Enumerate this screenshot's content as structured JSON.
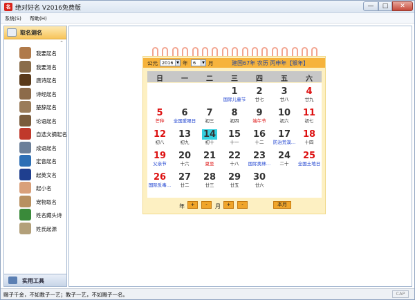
{
  "window": {
    "title": "绝对好名 V2016免费版",
    "icon": "app-icon"
  },
  "menu": [
    {
      "label": "系统(S)"
    },
    {
      "label": "帮助(H)"
    }
  ],
  "sidebar": {
    "header": "取名测名",
    "scroll_up": "⌃",
    "items": [
      {
        "label": "我要起名",
        "icon": "person-icon",
        "color": "#b07a4a"
      },
      {
        "label": "我要测名",
        "icon": "magnifier-person-icon",
        "color": "#8a6d4a"
      },
      {
        "label": "唐诗起名",
        "icon": "tang-seal-icon",
        "color": "#5a3a1a"
      },
      {
        "label": "诗经起名",
        "icon": "scroll-painting-icon",
        "color": "#8c6b4a"
      },
      {
        "label": "楚辞起名",
        "icon": "ancient-figure-icon",
        "color": "#9a7c5a"
      },
      {
        "label": "论语起名",
        "icon": "confucius-icon",
        "color": "#7a5c3c"
      },
      {
        "label": "自选文摘起名",
        "icon": "books-icon",
        "color": "#c0392b"
      },
      {
        "label": "成语起名",
        "icon": "book-icon",
        "color": "#6b7f99"
      },
      {
        "label": "定音起名",
        "icon": "globe-icon",
        "color": "#2d6fb5"
      },
      {
        "label": "起英文名",
        "icon": "uk-flag-icon",
        "color": "#1f3f8f"
      },
      {
        "label": "起小名",
        "icon": "baby-icon",
        "color": "#d9a07a"
      },
      {
        "label": "宠物取名",
        "icon": "dog-icon",
        "color": "#b89060"
      },
      {
        "label": "姓名藏头诗",
        "icon": "green-character-icon",
        "color": "#3a8a3a"
      },
      {
        "label": "姓氏起源",
        "icon": "parchment-icon",
        "color": "#b3a07a"
      }
    ],
    "footer": "实用工具"
  },
  "calendar": {
    "era_label": "公元",
    "year_value": "2016",
    "year_label": "年",
    "month_value": "6",
    "month_label": "月",
    "lunar_info": "建国67年 农历 丙申年【猴年】",
    "weekdays": [
      "日",
      "一",
      "二",
      "三",
      "四",
      "五",
      "六"
    ],
    "days": [
      {
        "num": "1",
        "sub": "国际儿童节",
        "num_color": "#333333",
        "sub_color": "#1a3fcf",
        "col": 3,
        "row": 0
      },
      {
        "num": "2",
        "sub": "廿七",
        "num_color": "#333333",
        "sub_color": "#333333",
        "col": 4,
        "row": 0
      },
      {
        "num": "3",
        "sub": "廿八",
        "num_color": "#333333",
        "sub_color": "#333333",
        "col": 5,
        "row": 0
      },
      {
        "num": "4",
        "sub": "廿九",
        "num_color": "#dd1111",
        "sub_color": "#333333",
        "col": 6,
        "row": 0
      },
      {
        "num": "5",
        "sub": "芒种",
        "num_color": "#dd1111",
        "sub_color": "#dd1111",
        "col": 0,
        "row": 1
      },
      {
        "num": "6",
        "sub": "全国爱眼日",
        "num_color": "#333333",
        "sub_color": "#1a3fcf",
        "col": 1,
        "row": 1
      },
      {
        "num": "7",
        "sub": "初三",
        "num_color": "#333333",
        "sub_color": "#333333",
        "col": 2,
        "row": 1
      },
      {
        "num": "8",
        "sub": "初四",
        "num_color": "#333333",
        "sub_color": "#333333",
        "col": 3,
        "row": 1
      },
      {
        "num": "9",
        "sub": "端午节",
        "num_color": "#333333",
        "sub_color": "#dd1111",
        "col": 4,
        "row": 1
      },
      {
        "num": "10",
        "sub": "初六",
        "num_color": "#333333",
        "sub_color": "#333333",
        "col": 5,
        "row": 1
      },
      {
        "num": "11",
        "sub": "初七",
        "num_color": "#dd1111",
        "sub_color": "#333333",
        "col": 6,
        "row": 1
      },
      {
        "num": "12",
        "sub": "初八",
        "num_color": "#dd1111",
        "sub_color": "#333333",
        "col": 0,
        "row": 2
      },
      {
        "num": "13",
        "sub": "初九",
        "num_color": "#333333",
        "sub_color": "#333333",
        "col": 1,
        "row": 2
      },
      {
        "num": "14",
        "sub": "初十",
        "num_color": "#333333",
        "sub_color": "#333333",
        "col": 2,
        "row": 2,
        "today": true
      },
      {
        "num": "15",
        "sub": "十一",
        "num_color": "#333333",
        "sub_color": "#333333",
        "col": 3,
        "row": 2
      },
      {
        "num": "16",
        "sub": "十二",
        "num_color": "#333333",
        "sub_color": "#333333",
        "col": 4,
        "row": 2
      },
      {
        "num": "17",
        "sub": "防治荒漠…",
        "num_color": "#333333",
        "sub_color": "#1a3fcf",
        "col": 5,
        "row": 2
      },
      {
        "num": "18",
        "sub": "十四",
        "num_color": "#dd1111",
        "sub_color": "#333333",
        "col": 6,
        "row": 2
      },
      {
        "num": "19",
        "sub": "父亲节",
        "num_color": "#dd1111",
        "sub_color": "#1a3fcf",
        "col": 0,
        "row": 3
      },
      {
        "num": "20",
        "sub": "十六",
        "num_color": "#333333",
        "sub_color": "#333333",
        "col": 1,
        "row": 3
      },
      {
        "num": "21",
        "sub": "夏至",
        "num_color": "#333333",
        "sub_color": "#dd1111",
        "col": 2,
        "row": 3
      },
      {
        "num": "22",
        "sub": "十八",
        "num_color": "#333333",
        "sub_color": "#333333",
        "col": 3,
        "row": 3
      },
      {
        "num": "23",
        "sub": "国际奥林…",
        "num_color": "#333333",
        "sub_color": "#1a3fcf",
        "col": 4,
        "row": 3
      },
      {
        "num": "24",
        "sub": "二十",
        "num_color": "#333333",
        "sub_color": "#333333",
        "col": 5,
        "row": 3
      },
      {
        "num": "25",
        "sub": "全国土地日",
        "num_color": "#dd1111",
        "sub_color": "#1a3fcf",
        "col": 6,
        "row": 3
      },
      {
        "num": "26",
        "sub": "国际反毒…",
        "num_color": "#dd1111",
        "sub_color": "#1a3fcf",
        "col": 0,
        "row": 4
      },
      {
        "num": "27",
        "sub": "廿二",
        "num_color": "#333333",
        "sub_color": "#333333",
        "col": 1,
        "row": 4
      },
      {
        "num": "28",
        "sub": "廿三",
        "num_color": "#333333",
        "sub_color": "#333333",
        "col": 2,
        "row": 4
      },
      {
        "num": "29",
        "sub": "廿五",
        "num_color": "#333333",
        "sub_color": "#333333",
        "col": 3,
        "row": 4
      },
      {
        "num": "30",
        "sub": "廿六",
        "num_color": "#333333",
        "sub_color": "#333333",
        "col": 4,
        "row": 4
      }
    ],
    "nav": {
      "year_label": "年",
      "month_label": "月",
      "plus": "+",
      "minus": "-",
      "this_month": "本月"
    }
  },
  "status": {
    "text": "赐子千金，不如教子一艺；教子一艺，不如赐子一名。",
    "cap": "CAP"
  },
  "colors": {
    "accent_orange": "#f6b33c",
    "weekend_red": "#dd1111",
    "festival_blue": "#1a3fcf",
    "today_cyan": "#33d0e0"
  }
}
